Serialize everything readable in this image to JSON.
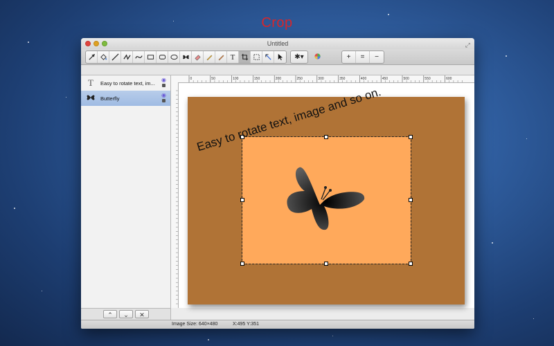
{
  "banner": {
    "text": "Crop"
  },
  "window": {
    "title": "Untitled"
  },
  "toolbar": {
    "tools": [
      "eyedropper-icon",
      "paint-bucket-icon",
      "line-icon",
      "zigzag-icon",
      "curve-icon",
      "rectangle-icon",
      "rounded-rect-icon",
      "ellipse-icon",
      "butterfly-shape-icon",
      "eraser-icon",
      "pencil-icon",
      "pen-icon",
      "text-icon",
      "crop-icon",
      "marquee-icon",
      "lasso-icon",
      "pointer-icon"
    ],
    "active_tool": "crop-icon",
    "gear_label": "✱▾",
    "zoom_in": "+",
    "zoom_actual": "=",
    "zoom_out": "−"
  },
  "layers": [
    {
      "icon": "T",
      "name": "Easy to rotate text, im...",
      "selected": false
    },
    {
      "icon": "butterfly",
      "name": "Butterfly",
      "selected": true
    }
  ],
  "layer_controls": {
    "up": "⌃",
    "down": "⌄",
    "delete": "✕"
  },
  "ruler": {
    "top_labels": [
      "0",
      "50",
      "100",
      "150",
      "200",
      "250",
      "300",
      "350",
      "400",
      "450",
      "500",
      "550",
      "600"
    ]
  },
  "canvas": {
    "rotated_text": "Easy to rotate text, image and so on.",
    "background_color": "#b07336",
    "crop_fill_color": "#ffa95b"
  },
  "status": {
    "image_size": "Image Size: 640×480",
    "coords": "X:495 Y:351"
  }
}
